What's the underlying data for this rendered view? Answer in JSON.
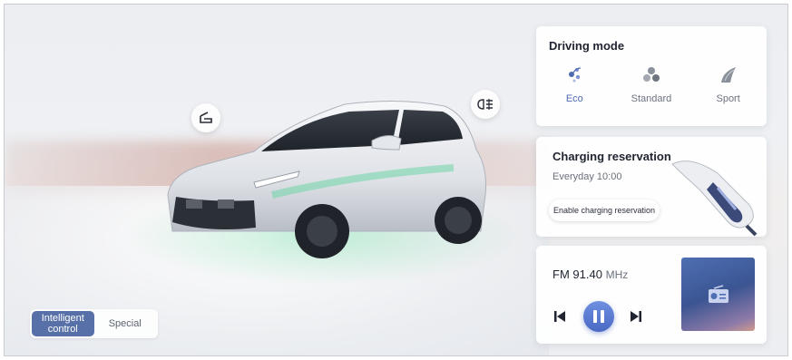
{
  "left_panel": {
    "mode_toggle": {
      "intelligent_control": "Intelligent\ncontrol",
      "special": "Special"
    }
  },
  "driving_mode": {
    "title": "Driving mode",
    "options": [
      {
        "label": "Eco",
        "icon": "eco-leaf-icon",
        "active": true
      },
      {
        "label": "Standard",
        "icon": "standard-drop-icon",
        "active": false
      },
      {
        "label": "Sport",
        "icon": "sport-wing-icon",
        "active": false
      }
    ]
  },
  "charging": {
    "title": "Charging reservation",
    "schedule": "Everyday 10:00",
    "button_label": "Enable charging reservation"
  },
  "radio": {
    "band": "FM",
    "frequency": "91.40",
    "unit": "MHz"
  },
  "colors": {
    "accent": "#4e6bb0",
    "toggle_active": "#5870a8",
    "play_button": "#4a69c4"
  }
}
